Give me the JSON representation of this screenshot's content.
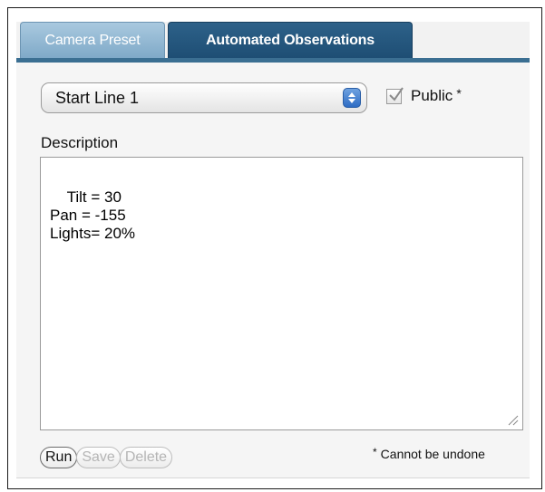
{
  "tabs": [
    {
      "label": "Camera Preset",
      "active": true
    },
    {
      "label": "Automated Observations",
      "active": false
    }
  ],
  "preset_select": {
    "value": "Start Line 1"
  },
  "public_checkbox": {
    "label": "Public",
    "marker": "*",
    "checked": true
  },
  "description": {
    "label": "Description",
    "value": "Tilt = 30\nPan = -155\nLights= 20%"
  },
  "buttons": {
    "run": "Run",
    "save": "Save",
    "delete": "Delete"
  },
  "note": {
    "marker": "*",
    "text": "Cannot be undone"
  },
  "colors": {
    "tab_active": "#8fb5d2",
    "tab_inactive": "#265a80",
    "tab_underline": "#3b6f92"
  }
}
